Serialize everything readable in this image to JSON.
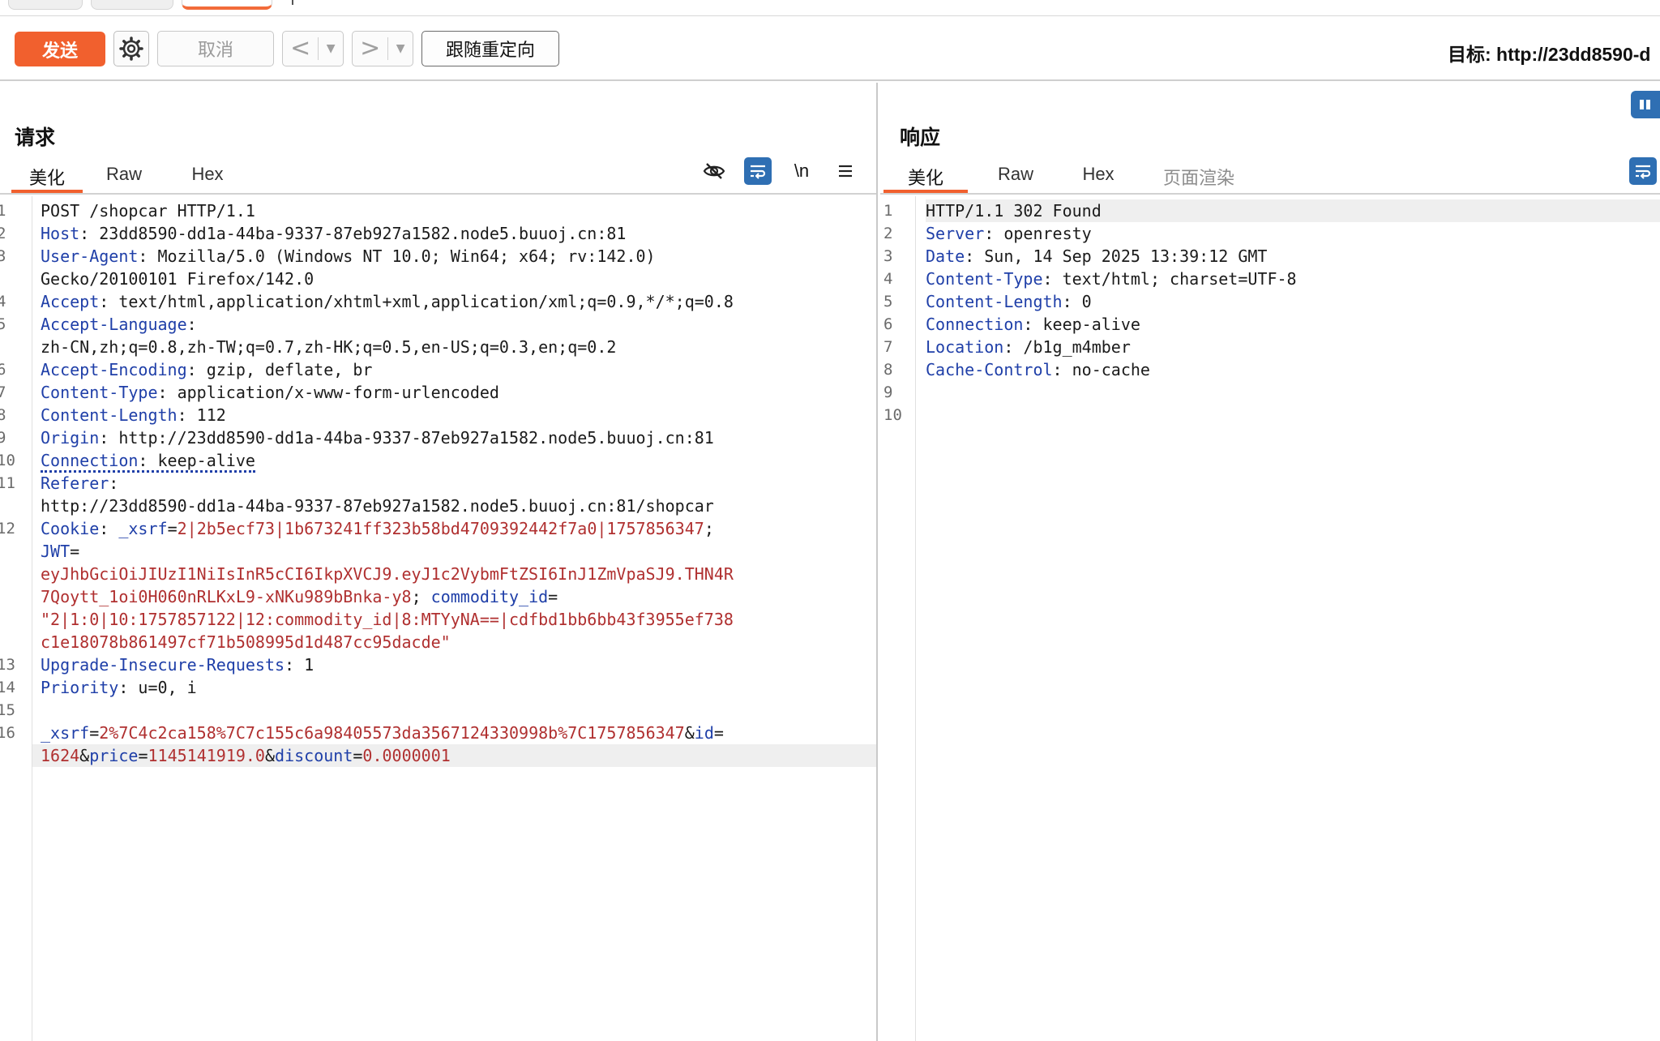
{
  "toolbar": {
    "send_label": "发送",
    "cancel_label": "取消",
    "back_arrow": "<",
    "forward_arrow": ">",
    "dropdown_glyph": "▼",
    "follow_redirect_label": "跟随重定向",
    "target_label": "目标: http://23dd8590-d"
  },
  "colors": {
    "accent": "#f1602e",
    "header_key": "#1f3fa8",
    "param_value": "#b03030",
    "toggle_blue": "#2f6fb3"
  },
  "request": {
    "title": "请求",
    "tabs": [
      "美化",
      "Raw",
      "Hex"
    ],
    "newline_toggle": "\\n",
    "icons": [
      "hide-eye-icon",
      "wrap-icon",
      "newline-icon",
      "menu-icon"
    ],
    "line_numbers": [
      "1",
      "2",
      "3",
      "",
      "4",
      "5",
      "",
      "6",
      "7",
      "8",
      "9",
      "10",
      "11",
      "",
      "12",
      "",
      "",
      "",
      "",
      "",
      "13",
      "14",
      "15",
      "16",
      ""
    ]
  },
  "response": {
    "title": "响应",
    "tabs": [
      "美化",
      "Raw",
      "Hex",
      "页面渲染"
    ],
    "line_numbers": [
      "1",
      "2",
      "3",
      "4",
      "5",
      "6",
      "7",
      "8",
      "9",
      "10"
    ]
  }
}
